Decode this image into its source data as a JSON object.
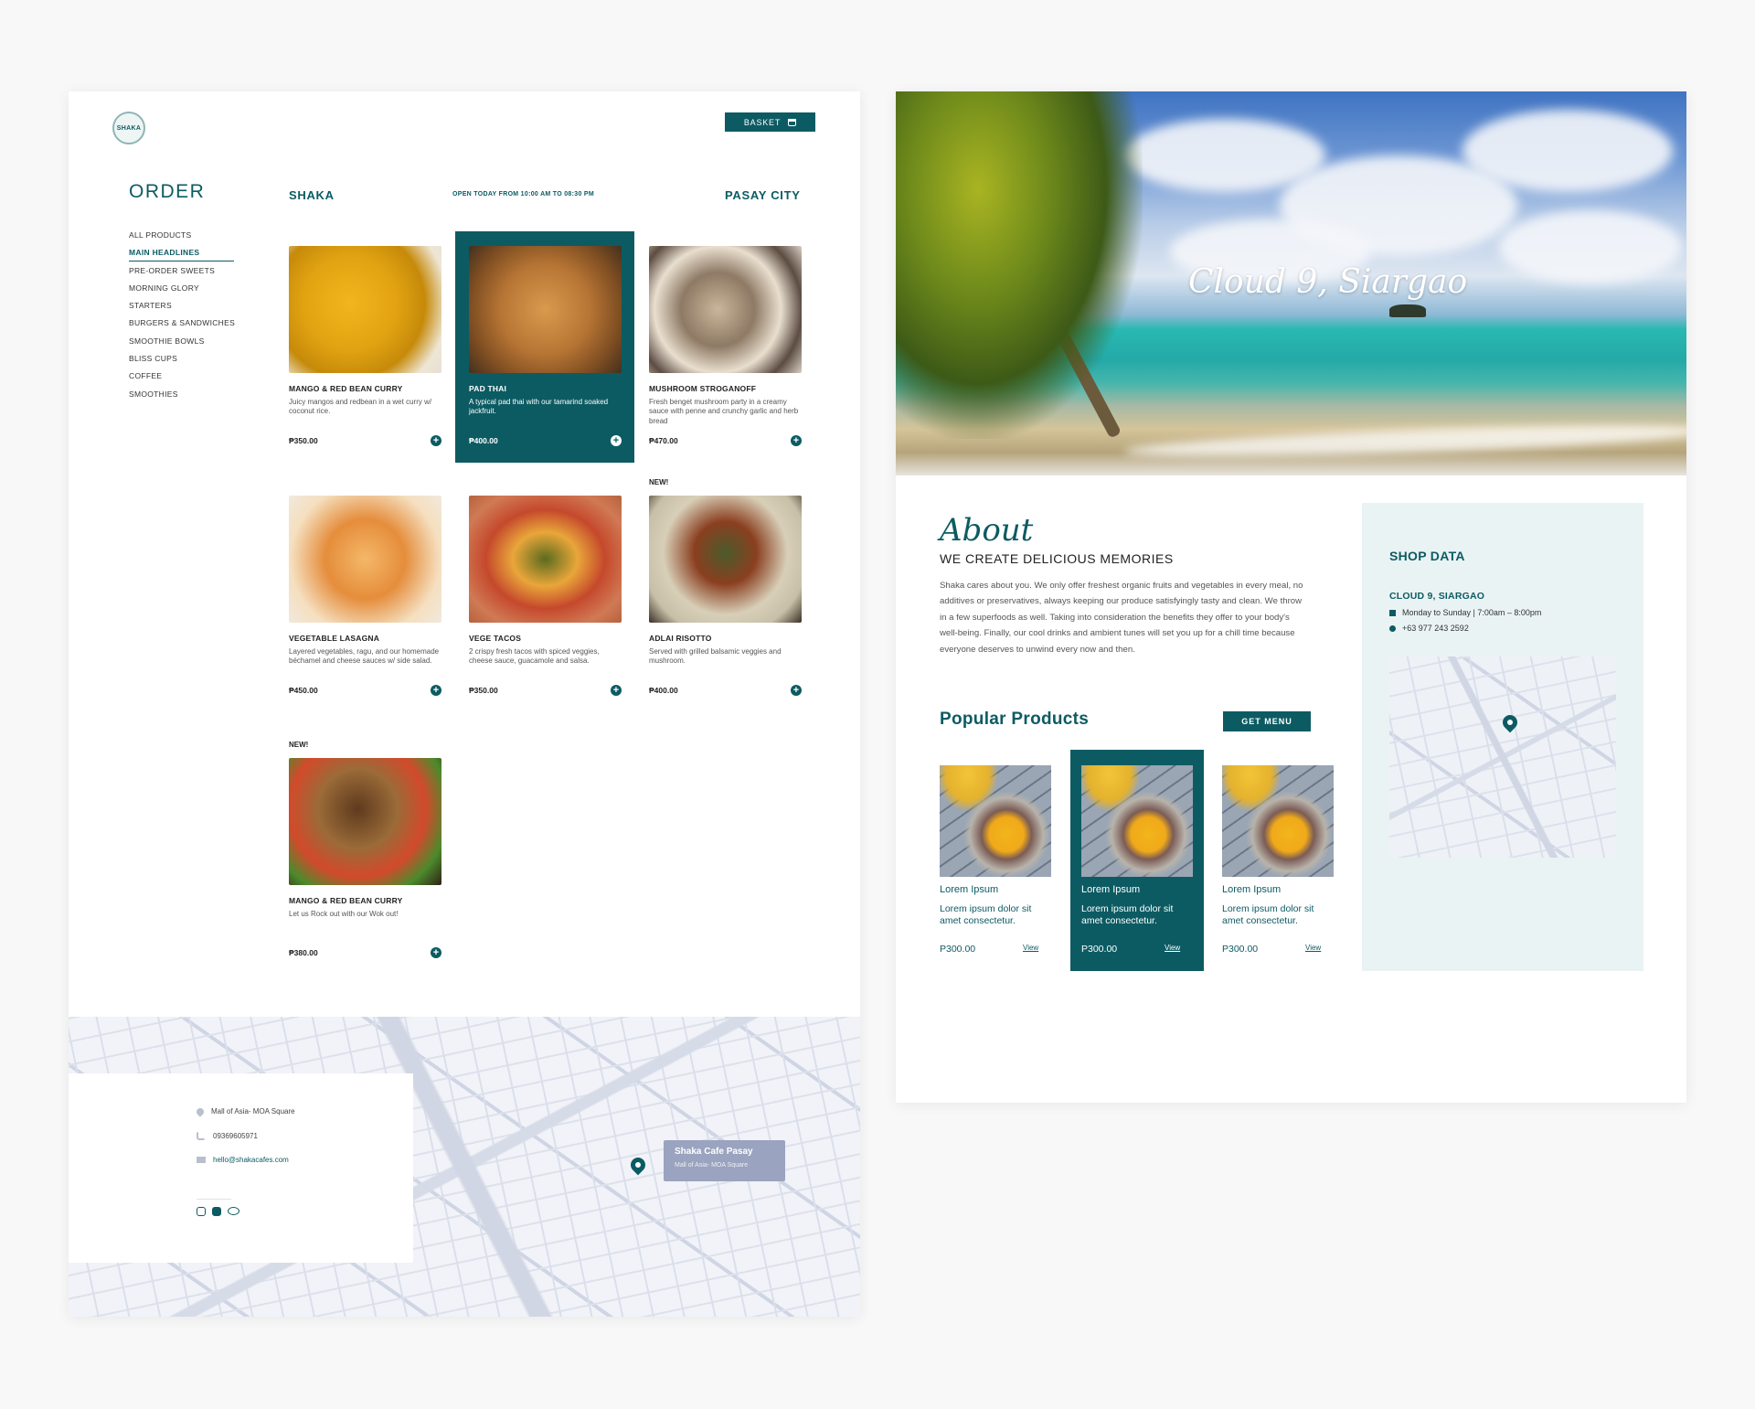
{
  "brand": {
    "logo_text": "SHAKA",
    "primary_color": "#0c5b63"
  },
  "header": {
    "basket_label": "BASKET"
  },
  "order": {
    "title": "ORDER",
    "shop_name": "SHAKA",
    "hours": "OPEN TODAY FROM 10:00 AM TO 08:30 PM",
    "city": "PASAY CITY",
    "categories": [
      "ALL PRODUCTS",
      "MAIN HEADLINES",
      "PRE-ORDER SWEETS",
      "MORNING GLORY",
      "STARTERS",
      "BURGERS & SANDWICHES",
      "SMOOTHIE BOWLS",
      "BLISS CUPS",
      "COFFEE",
      "SMOOTHIES"
    ],
    "active_category": "MAIN HEADLINES",
    "products": [
      {
        "name": "MANGO & RED BEAN CURRY",
        "desc": "Juicy mangos and redbean in a wet curry w/ coconut rice.",
        "price": "₱350.00"
      },
      {
        "name": "PAD THAI",
        "desc": "A typical pad thai with our tamarind soaked jackfruit.",
        "price": "₱400.00"
      },
      {
        "name": "MUSHROOM STROGANOFF",
        "desc": "Fresh benget mushroom party in a creamy sauce with penne and crunchy garlic and herb bread",
        "price": "₱470.00"
      },
      {
        "name": "VEGETABLE LASAGNA",
        "desc": "Layered vegetables, ragu, and our homemade béchamel and cheese sauces w/ side salad.",
        "price": "₱450.00"
      },
      {
        "name": "VEGE TACOS",
        "desc": "2 crispy fresh tacos with spiced veggies, cheese sauce, guacamole and salsa.",
        "price": "₱350.00"
      },
      {
        "name": "ADLAI RISOTTO",
        "desc": "Served with grilled balsamic veggies and mushroom.",
        "price": "₱400.00",
        "tag": "NEW!"
      },
      {
        "name": "MANGO & RED BEAN CURRY",
        "desc": "Let us Rock out with our Wok out!",
        "price": "₱380.00",
        "tag": "NEW!"
      }
    ],
    "add_icon": "+"
  },
  "contact": {
    "address": "Mall of Asia- MOA Square",
    "phone": "09369605971",
    "email": "hello@shakacafes.com",
    "map_tooltip_title": "Shaka Cafe Pasay",
    "map_tooltip_sub": "Mall of Asia- MOA Square",
    "social_icons": [
      "instagram-icon",
      "facebook-icon",
      "tripadvisor-icon"
    ]
  },
  "hero": {
    "title": "Cloud 9, Siargao"
  },
  "about": {
    "script_title": "About",
    "subtitle": "WE CREATE DELICIOUS MEMORIES",
    "body": "Shaka cares about you. We only offer freshest organic fruits and vegetables in every meal, no additives or preservatives, always keeping our produce satisfyingly tasty and clean. We throw in a few superfoods as well. Taking into consideration the benefits they offer to your body's well-being. Finally, our cool drinks and ambient tunes will set you up for a chill time because everyone deserves to unwind every now and then."
  },
  "popular": {
    "title": "Popular Products",
    "get_menu_label": "GET MENU",
    "items": [
      {
        "name": "Lorem Ipsum",
        "desc": "Lorem ipsum dolor sit amet consectetur.",
        "price": "P300.00",
        "view": "View"
      },
      {
        "name": "Lorem Ipsum",
        "desc": "Lorem ipsum dolor sit amet consectetur.",
        "price": "P300.00",
        "view": "View"
      },
      {
        "name": "Lorem Ipsum",
        "desc": "Lorem ipsum dolor sit amet consectetur.",
        "price": "P300.00",
        "view": "View"
      }
    ]
  },
  "shop_data": {
    "title": "SHOP DATA",
    "location": "CLOUD 9, SIARGAO",
    "hours": "Monday to Sunday | 7:00am – 8:00pm",
    "phone": "+63 977 243 2592"
  }
}
